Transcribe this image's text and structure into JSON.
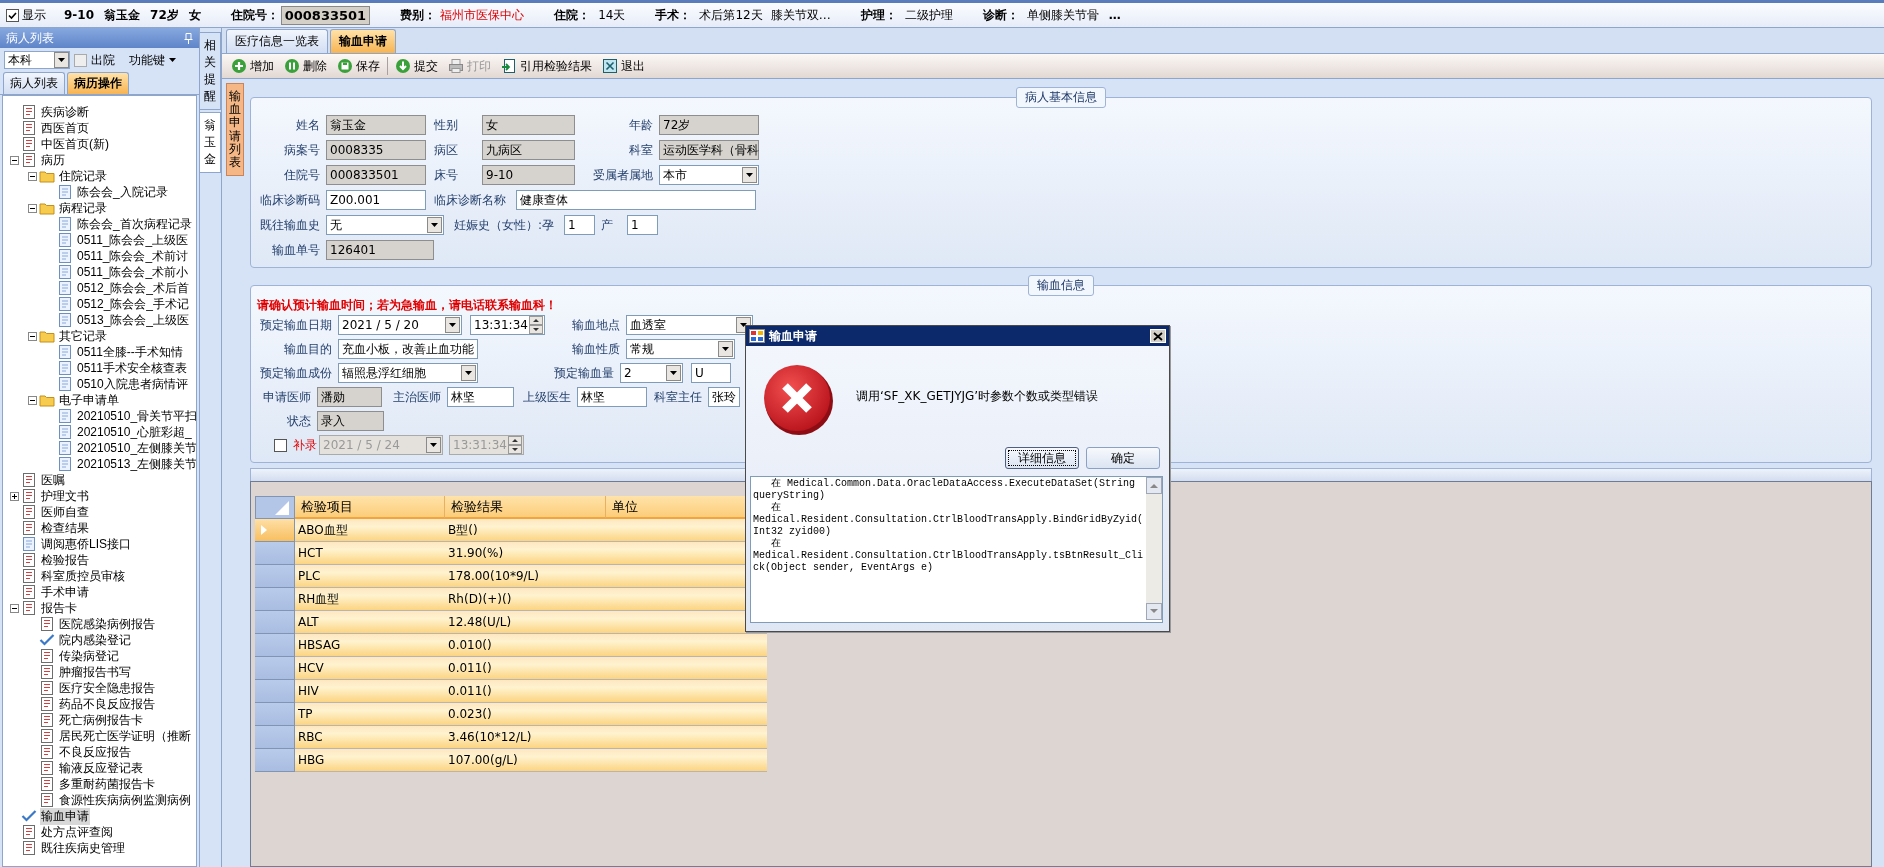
{
  "patient_bar": {
    "show_checkbox": {
      "label": "显示",
      "checked": true
    },
    "items": [
      {
        "text": "9-10",
        "kind": "bold"
      },
      {
        "text": "翁玉金",
        "kind": "bold"
      },
      {
        "text": "72岁",
        "kind": "bold"
      },
      {
        "text": "女",
        "kind": "bold"
      },
      {
        "text": "住院号：",
        "kind": "label"
      },
      {
        "text": "000833501",
        "kind": "boxed"
      },
      {
        "text": "费别：",
        "kind": "label"
      },
      {
        "text": "福州市医保中心",
        "kind": "alert"
      },
      {
        "text": "住院：",
        "kind": "label"
      },
      {
        "text": "14天",
        "kind": "value"
      },
      {
        "text": "手术：",
        "kind": "label"
      },
      {
        "text": "术后第12天",
        "kind": "value"
      },
      {
        "text": "膝关节双…",
        "kind": "value"
      },
      {
        "text": "护理：",
        "kind": "label"
      },
      {
        "text": "二级护理",
        "kind": "value"
      },
      {
        "text": "诊断：",
        "kind": "label"
      },
      {
        "text": "单侧膝关节骨",
        "kind": "value"
      },
      {
        "text": "…",
        "kind": "bold"
      }
    ]
  },
  "left_panel": {
    "title": "病人列表",
    "scope_select": {
      "value": "本科"
    },
    "discharged_checkbox": {
      "label": "出院",
      "checked": false
    },
    "function_menu": {
      "label": "功能键"
    },
    "tabs": [
      {
        "label": "病人列表",
        "selected": false
      },
      {
        "label": "病历操作",
        "selected": true
      }
    ],
    "tree": [
      {
        "label": "疾病诊断",
        "kind": "doc",
        "selected": false
      },
      {
        "label": "西医首页",
        "kind": "doc",
        "selected": false
      },
      {
        "label": "中医首页(新)",
        "kind": "doc",
        "selected": false
      },
      {
        "label": "病历",
        "kind": "doc",
        "selected": false,
        "expanded": true,
        "children": [
          {
            "label": "住院记录",
            "kind": "folder",
            "selected": false,
            "expanded": true,
            "children": [
              {
                "label": "陈会会_入院记录",
                "kind": "page",
                "selected": false
              }
            ]
          },
          {
            "label": "病程记录",
            "kind": "folder",
            "selected": false,
            "expanded": true,
            "children": [
              {
                "label": "陈会会_首次病程记录",
                "kind": "page",
                "selected": false
              },
              {
                "label": "0511_陈会会_上级医",
                "kind": "page",
                "selected": false
              },
              {
                "label": "0511_陈会会_术前讨",
                "kind": "page",
                "selected": false
              },
              {
                "label": "0511_陈会会_术前小",
                "kind": "page",
                "selected": false
              },
              {
                "label": "0512_陈会会_术后首",
                "kind": "page",
                "selected": false
              },
              {
                "label": "0512_陈会会_手术记",
                "kind": "page",
                "selected": false
              },
              {
                "label": "0513_陈会会_上级医",
                "kind": "page",
                "selected": false
              }
            ]
          },
          {
            "label": "其它记录",
            "kind": "folder",
            "selected": false,
            "expanded": true,
            "children": [
              {
                "label": "0511全膝--手术知情",
                "kind": "page",
                "selected": false
              },
              {
                "label": "0511手术安全核查表",
                "kind": "page",
                "selected": false
              },
              {
                "label": "0510入院患者病情评",
                "kind": "page",
                "selected": false
              }
            ]
          },
          {
            "label": "电子申请单",
            "kind": "folder",
            "selected": false,
            "expanded": true,
            "children": [
              {
                "label": "20210510_骨关节平扫",
                "kind": "page",
                "selected": false
              },
              {
                "label": "20210510_心脏彩超_",
                "kind": "page",
                "selected": false
              },
              {
                "label": "20210510_左侧膝关节",
                "kind": "page",
                "selected": false
              },
              {
                "label": "20210513_左侧膝关节",
                "kind": "page",
                "selected": false
              }
            ]
          }
        ]
      },
      {
        "label": "医嘱",
        "kind": "doc",
        "selected": false
      },
      {
        "label": "护理文书",
        "kind": "doc",
        "selected": false,
        "expanded": false
      },
      {
        "label": "医师自查",
        "kind": "doc",
        "selected": false
      },
      {
        "label": "检查结果",
        "kind": "doc",
        "selected": false
      },
      {
        "label": "调阅惠侨LIS接口",
        "kind": "page",
        "selected": false
      },
      {
        "label": "检验报告",
        "kind": "doc",
        "selected": false
      },
      {
        "label": "科室质控员审核",
        "kind": "doc",
        "selected": false
      },
      {
        "label": "手术申请",
        "kind": "doc",
        "selected": false
      },
      {
        "label": "报告卡",
        "kind": "doc",
        "selected": false,
        "expanded": true,
        "children": [
          {
            "label": "医院感染病例报告",
            "kind": "doc",
            "selected": false
          },
          {
            "label": "院内感染登记",
            "kind": "check",
            "selected": false
          },
          {
            "label": "传染病登记",
            "kind": "doc",
            "selected": false
          },
          {
            "label": "肿瘤报告书写",
            "kind": "doc",
            "selected": false
          },
          {
            "label": "医疗安全隐患报告",
            "kind": "doc",
            "selected": false
          },
          {
            "label": "药品不良反应报告",
            "kind": "doc",
            "selected": false
          },
          {
            "label": "死亡病例报告卡",
            "kind": "doc",
            "selected": false
          },
          {
            "label": "居民死亡医学证明（推断",
            "kind": "doc",
            "selected": false
          },
          {
            "label": "不良反应报告",
            "kind": "doc",
            "selected": false
          },
          {
            "label": "输液反应登记表",
            "kind": "doc",
            "selected": false
          },
          {
            "label": "多重耐药菌报告卡",
            "kind": "doc",
            "selected": false
          },
          {
            "label": "食源性疾病病例监测病例",
            "kind": "doc",
            "selected": false
          }
        ]
      },
      {
        "label": "输血申请",
        "kind": "check",
        "selected": true
      },
      {
        "label": "处方点评查阅",
        "kind": "doc",
        "selected": false
      },
      {
        "label": "既往疾病史管理",
        "kind": "doc",
        "selected": false
      }
    ]
  },
  "side_tabs": [
    {
      "label": "相关提醒",
      "selected": false
    },
    {
      "label": "翁玉金",
      "selected": true
    }
  ],
  "main_tabs": [
    {
      "label": "医疗信息一览表",
      "selected": false
    },
    {
      "label": "输血申请",
      "selected": true
    }
  ],
  "toolbar": [
    {
      "label": "增加",
      "kind": "add",
      "disabled": false
    },
    {
      "label": "删除",
      "kind": "delete",
      "disabled": false
    },
    {
      "label": "保存",
      "kind": "save",
      "disabled": false
    },
    {
      "label": "提交",
      "kind": "submit",
      "disabled": false
    },
    {
      "label": "打印",
      "kind": "print",
      "disabled": true
    },
    {
      "label": "引用检验结果",
      "kind": "import",
      "disabled": false
    },
    {
      "label": "退出",
      "kind": "exit",
      "disabled": false
    }
  ],
  "list_tab": {
    "label": "输血申请列表"
  },
  "basic_info": {
    "title": "病人基本信息",
    "rows": [
      {
        "fields": [
          {
            "label": "姓名",
            "value": "翁玉金",
            "kind": "readonly"
          },
          {
            "label": "性别",
            "value": "女",
            "kind": "readonly"
          },
          {
            "label": "年龄",
            "value": "72岁",
            "kind": "readonly"
          }
        ]
      },
      {
        "fields": [
          {
            "label": "病案号",
            "value": "0008335",
            "kind": "readonly"
          },
          {
            "label": "病区",
            "value": "九病区",
            "kind": "readonly"
          },
          {
            "label": "科室",
            "value": "运动医学科（骨科",
            "kind": "readonly"
          }
        ]
      },
      {
        "fields": [
          {
            "label": "住院号",
            "value": "000833501",
            "kind": "readonly"
          },
          {
            "label": "床号",
            "value": "9-10",
            "kind": "readonly"
          },
          {
            "label": "受属者属地",
            "value": "本市",
            "kind": "select"
          }
        ]
      },
      {
        "fields": [
          {
            "label": "临床诊断码",
            "value": "Z00.001",
            "kind": "input"
          },
          {
            "label": "临床诊断名称",
            "value": "健康查体",
            "kind": "input"
          }
        ]
      },
      {
        "fields": [
          {
            "label": "既往输血史",
            "value": "无",
            "kind": "select"
          },
          {
            "label": "妊娠史（女性）:孕",
            "value": "1",
            "kind": "input"
          },
          {
            "label": "产",
            "value": "1",
            "kind": "input"
          }
        ]
      },
      {
        "fields": [
          {
            "label": "输血单号",
            "value": "126401",
            "kind": "readonly"
          }
        ]
      }
    ]
  },
  "transfusion_info": {
    "title": "输血信息",
    "notice": "请确认预计输血时间；若为急输血，请电话联系输血科！",
    "rows": [
      {
        "fields": [
          {
            "label": "预定输血日期",
            "value": "2021 / 5 / 20",
            "kind": "date",
            "disabled": false
          },
          {
            "value": "13:31:34",
            "kind": "time",
            "disabled": false
          },
          {
            "label": "输血地点",
            "value": "血透室",
            "kind": "select"
          }
        ]
      },
      {
        "fields": [
          {
            "label": "输血目的",
            "value": "充血小板，改善止血功能",
            "kind": "input"
          },
          {
            "label": "输血性质",
            "value": "常规",
            "kind": "select"
          }
        ]
      },
      {
        "fields": [
          {
            "label": "预定输血成份",
            "value": "辐照悬浮红细胞",
            "kind": "select"
          },
          {
            "label": "预定输血量",
            "value": "2",
            "kind": "select"
          },
          {
            "value": "U",
            "kind": "input"
          }
        ]
      },
      {
        "fields": [
          {
            "label": "申请医师",
            "value": "潘勋",
            "kind": "readonly"
          },
          {
            "label": "主治医师",
            "value": "林坚",
            "kind": "input"
          },
          {
            "label": "上级医生",
            "value": "林坚",
            "kind": "input"
          },
          {
            "label": "科室主任",
            "value": "张玲",
            "kind": "input"
          }
        ]
      },
      {
        "fields": [
          {
            "label": "状态",
            "value": "录入",
            "kind": "readonly"
          }
        ]
      },
      {
        "fields": [
          {
            "label": "补录",
            "kind": "checkbox",
            "checked": false
          },
          {
            "value": "2021 / 5 / 24",
            "kind": "date",
            "disabled": true
          },
          {
            "value": "13:31:34",
            "kind": "time",
            "disabled": true
          }
        ]
      }
    ]
  },
  "lab_table": {
    "columns": [
      "检验项目",
      "检验结果",
      "单位"
    ],
    "rows": [
      {
        "item": "ABO血型",
        "result": "B型()",
        "selected": true
      },
      {
        "item": "HCT",
        "result": "31.90(%)",
        "selected": false
      },
      {
        "item": "PLC",
        "result": "178.00(10*9/L)",
        "selected": false
      },
      {
        "item": "RH血型",
        "result": "Rh(D)(+)()",
        "selected": false
      },
      {
        "item": "ALT",
        "result": "12.48(U/L)",
        "selected": false
      },
      {
        "item": "HBSAG",
        "result": "0.010()",
        "selected": false
      },
      {
        "item": "HCV",
        "result": "0.011()",
        "selected": false
      },
      {
        "item": "HIV",
        "result": "0.011()",
        "selected": false
      },
      {
        "item": "TP",
        "result": "0.023()",
        "selected": false
      },
      {
        "item": "RBC",
        "result": "3.46(10*12/L)",
        "selected": false
      },
      {
        "item": "HBG",
        "result": "107.00(g/L)",
        "selected": false
      }
    ]
  },
  "dialog": {
    "title": "输血申请",
    "message": "调用‘SF_XK_GETJYJG’时参数个数或类型错误",
    "buttons": [
      {
        "label": "详细信息",
        "focused": true
      },
      {
        "label": "确定",
        "focused": false
      }
    ],
    "details": "   在 Medical.Common.Data.OracleDataAccess.ExecuteDataSet(String queryString)\n   在 Medical.Resident.Consultation.CtrlBloodTransApply.BindGridByZyid(Int32 zyid00)\n   在 Medical.Resident.Consultation.CtrlBloodTransApply.tsBtnResult_Click(Object sender, EventArgs e)"
  }
}
